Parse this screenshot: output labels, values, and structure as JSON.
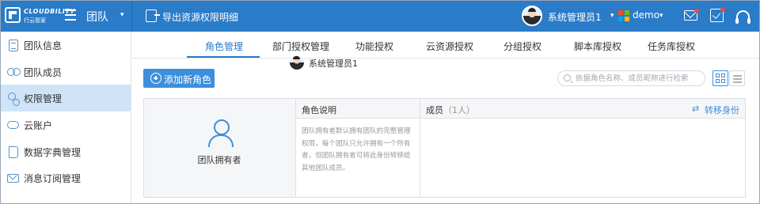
{
  "topbar": {
    "logo_text": "CLOUDBILITY",
    "logo_sub": "行云管家",
    "team_label": "团队",
    "export_label": "导出资源权限明细",
    "user_name": "系统管理员1",
    "org_name": "demo",
    "colors": {
      "bar": "#2a7bc8",
      "notify_dot": "#e84c3d"
    }
  },
  "sidebar": {
    "items": [
      {
        "label": "团队信息",
        "icon": "document-icon",
        "active": false
      },
      {
        "label": "团队成员",
        "icon": "people-icon",
        "active": false
      },
      {
        "label": "权限管理",
        "icon": "user-gear-icon",
        "active": true
      },
      {
        "label": "云账户",
        "icon": "cloud-icon",
        "active": false
      },
      {
        "label": "数据字典管理",
        "icon": "book-icon",
        "active": false
      },
      {
        "label": "消息订阅管理",
        "icon": "mail-icon",
        "active": false
      }
    ]
  },
  "tabs": [
    {
      "label": "角色管理",
      "active": true
    },
    {
      "label": "部门授权管理",
      "active": false
    },
    {
      "label": "功能授权",
      "active": false
    },
    {
      "label": "云资源授权",
      "active": false
    },
    {
      "label": "分组授权",
      "active": false
    },
    {
      "label": "脚本库授权",
      "active": false
    },
    {
      "label": "任务库授权",
      "active": false
    }
  ],
  "toolbar": {
    "add_role_label": "添加新角色",
    "search_placeholder": "依据角色名称、成员昵称进行检索",
    "view_mode": "grid"
  },
  "role_card": {
    "role_name": "团队拥有者",
    "desc_header": "角色说明",
    "description": "团队拥有者默认拥有团队的完整管理权限，每个团队只允许拥有一个所有者，但团队拥有者可将此身份转移给其他团队成员。",
    "members_header": "成员",
    "members_count": "（1人）",
    "transfer_label": "转移身份",
    "members": [
      {
        "name": "系统管理员1"
      }
    ]
  }
}
